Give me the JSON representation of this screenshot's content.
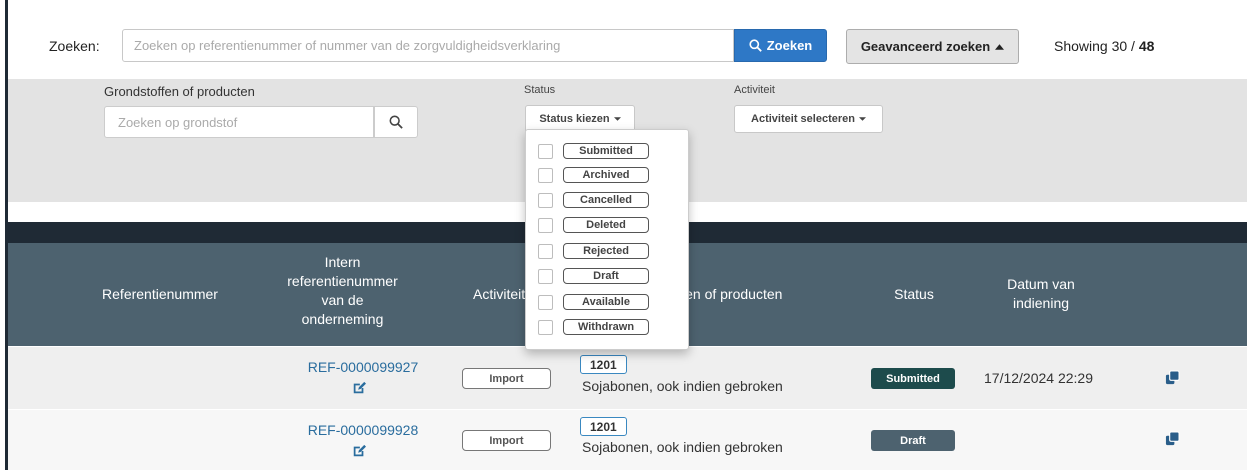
{
  "search": {
    "label": "Zoeken:",
    "placeholder": "Zoeken op referentienummer of nummer van de zorgvuldigheidsverklaring",
    "button_label": "Zoeken",
    "advanced_label": "Geavanceerd zoeken",
    "showing_prefix": "Showing 30 / ",
    "showing_total": "48"
  },
  "filters": {
    "grondstof_label": "Grondstoffen of producten",
    "grondstof_placeholder": "Zoeken op grondstof",
    "status_label": "Status",
    "status_button": "Status kiezen",
    "activiteit_label": "Activiteit",
    "activiteit_button": "Activiteit selecteren",
    "status_options": [
      "Submitted",
      "Archived",
      "Cancelled",
      "Deleted",
      "Rejected",
      "Draft",
      "Available",
      "Withdrawn"
    ]
  },
  "table": {
    "headers": {
      "ref": "Referentienummer",
      "intern": [
        "Intern",
        "referentienummer",
        "van de",
        "onderneming"
      ],
      "activiteit": "Activiteit",
      "grondstoffen": "Grondstoffen of producten",
      "status": "Status",
      "datum": [
        "Datum van",
        "indiening"
      ]
    },
    "rows": [
      {
        "intern_ref": "REF-0000099927",
        "activity": "Import",
        "code": "1201",
        "product": "Sojabonen, ook indien gebroken",
        "status": "Submitted",
        "date": "17/12/2024 22:29"
      },
      {
        "intern_ref": "REF-0000099928",
        "activity": "Import",
        "code": "1201",
        "product": "Sojabonen, ook indien gebroken",
        "status": "Draft",
        "date": ""
      }
    ]
  },
  "colors": {
    "primary_button": "#2e78c6",
    "table_header": "#4d626f",
    "submitted_badge": "#1d4b4c",
    "draft_badge": "#4d626f",
    "link": "#2a6d9e"
  }
}
